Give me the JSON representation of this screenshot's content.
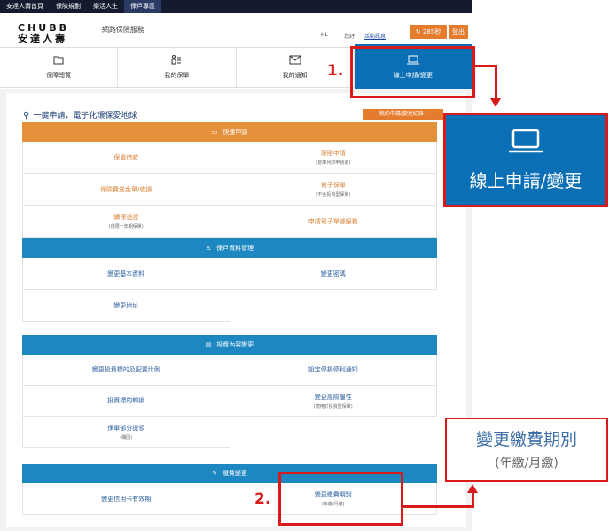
{
  "topbar": {
    "links": [
      "安達人壽首頁",
      "保險規劃",
      "樂活人生",
      "保戶專區"
    ]
  },
  "header": {
    "logo_en": "CHUBB",
    "logo_zh": "安達人壽",
    "subtitle": "網路保險服務",
    "user_name": "HL",
    "greeting": "您好",
    "message_link": "活動訊息",
    "session_timer": "285秒",
    "logout_label": "登出"
  },
  "nav": {
    "items": [
      {
        "label": "保障總覽",
        "icon": "folder-icon"
      },
      {
        "label": "我的保單",
        "icon": "policy-list-icon"
      },
      {
        "label": "我的通知",
        "icon": "mail-icon"
      },
      {
        "label": "線上申請/變更",
        "icon": "laptop-icon"
      }
    ],
    "active_index": 3
  },
  "page": {
    "title": "一鍵申請，電子化環保愛地球",
    "record_button": "我的申請/變更紀錄 ›"
  },
  "sections": {
    "quick": {
      "title": "快速申請",
      "icon": "laptop-icon",
      "items": [
        {
          "label": "保單借款",
          "sub": ""
        },
        {
          "label": "理賠申請",
          "sub": "(倉庫列印申請書)"
        },
        {
          "label": "保險費送金單/收據",
          "sub": ""
        },
        {
          "label": "電子保單",
          "sub": "(不含投資型保單)"
        },
        {
          "label": "續保憑證",
          "sub": "(僅限一年期保單)"
        },
        {
          "label": "申請電子單據服務",
          "sub": ""
        }
      ]
    },
    "profile": {
      "title": "保戶資料管理",
      "icon": "person-icon",
      "items": [
        {
          "label": "變更基本資料",
          "sub": ""
        },
        {
          "label": "變更密碼",
          "sub": ""
        },
        {
          "label": "變更地址",
          "sub": ""
        }
      ]
    },
    "investment": {
      "title": "投資內容變更",
      "icon": "chart-card-icon",
      "items": [
        {
          "label": "變更投資標的及配置比例",
          "sub": ""
        },
        {
          "label": "設定停損停利通知",
          "sub": ""
        },
        {
          "label": "投資標的轉換",
          "sub": ""
        },
        {
          "label": "變更風險屬性",
          "sub": "(適用於投資型保單)"
        },
        {
          "label": "保單部分提領",
          "sub": "(贖回)"
        }
      ]
    },
    "payment": {
      "title": "繳費變更",
      "icon": "pencil-icon",
      "items": [
        {
          "label": "變更信用卡有效期",
          "sub": ""
        },
        {
          "label": "變更繳費期別",
          "sub": "(年繳/月繳)"
        }
      ]
    }
  },
  "annotations": {
    "step1": "1.",
    "step2": "2.",
    "callout1_label": "線上申請/變更",
    "callout2_label": "變更繳費期別",
    "callout2_sub": "(年繳/月繳)",
    "color": "#d91a1a"
  },
  "colors": {
    "topbar": "#141b2e",
    "nav_active": "#0a6fb5",
    "orange": "#e4903c",
    "blue": "#1c87c0",
    "button_orange": "#e47b2d"
  }
}
